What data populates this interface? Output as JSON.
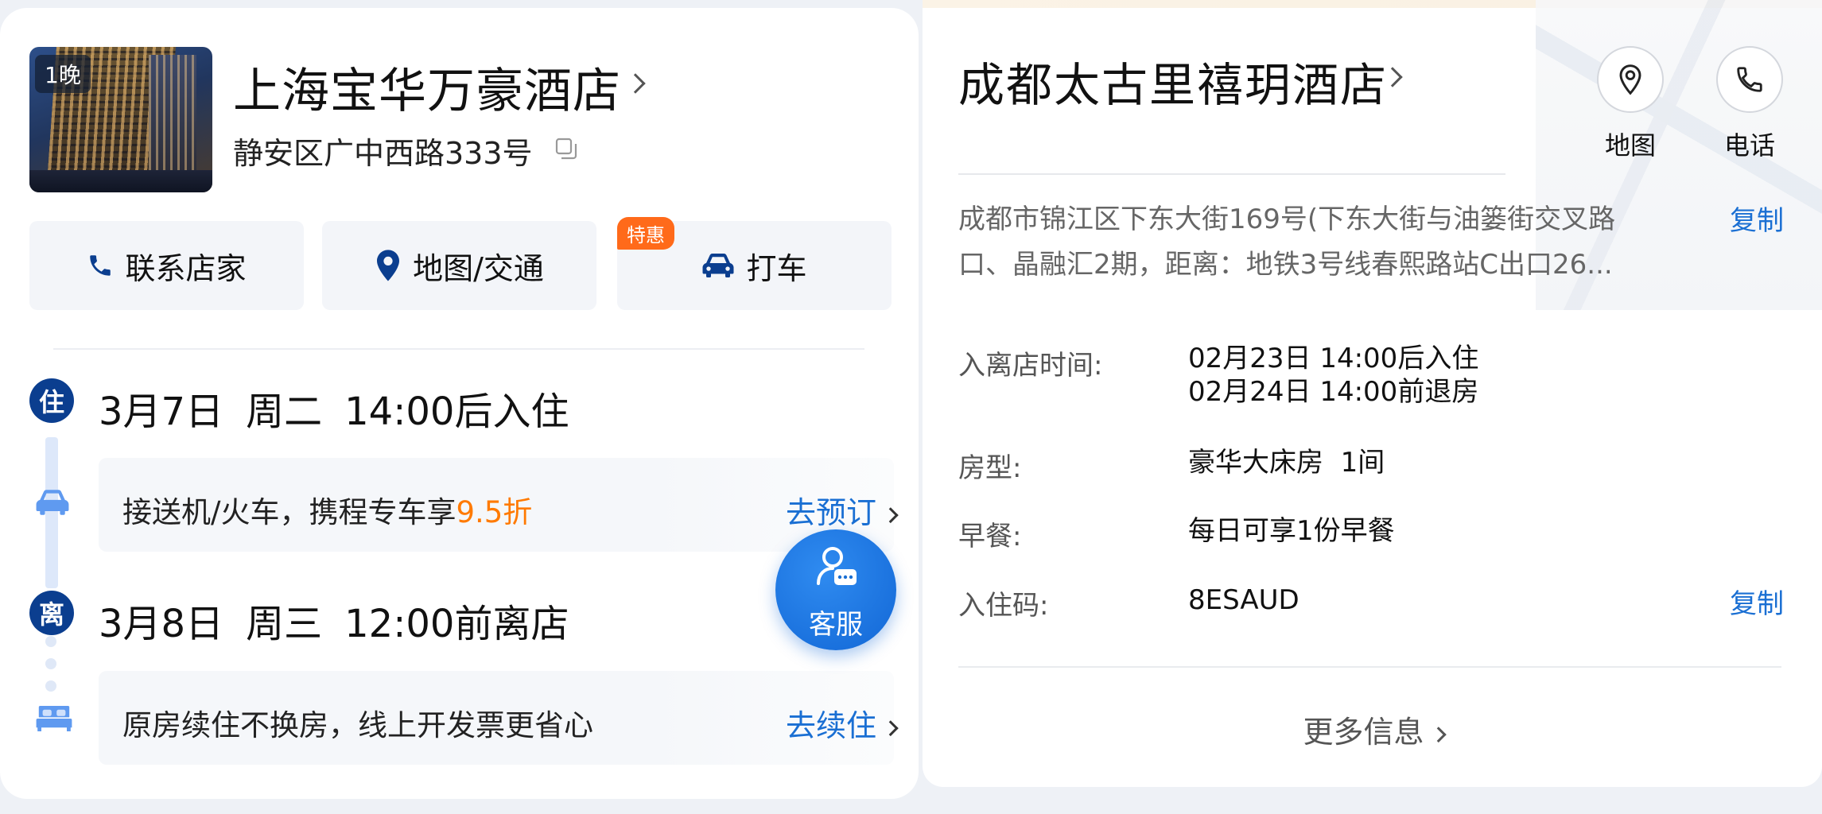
{
  "left": {
    "nights_badge": "1晚",
    "hotel_name": "上海宝华万豪酒店",
    "address": "静安区广中西路333号",
    "actions": {
      "contact": "联系店家",
      "map": "地图/交通",
      "taxi": "打车",
      "taxi_tag": "特惠"
    },
    "checkin": {
      "tag": "住",
      "date": "3月7日",
      "weekday": "周二",
      "time": "14:00后入住"
    },
    "transfer_promo": {
      "text": "接送机/火车，携程专车享",
      "discount": "9.5折",
      "link": "去预订"
    },
    "checkout": {
      "tag": "离",
      "date": "3月8日",
      "weekday": "周三",
      "time": "12:00前离店"
    },
    "extend_promo": {
      "text": "原房续住不换房，线上开发票更省心",
      "link": "去续住"
    },
    "customer_service": "客服"
  },
  "right": {
    "hotel_name": "成都太古里禧玥酒店",
    "map_label": "地图",
    "phone_label": "电话",
    "address_line1": "成都市锦江区下东大街169号(下东大街与油篓街交叉路",
    "address_line2": "口、晶融汇2期，距离：地铁3号线春熙路站C出口26...",
    "copy_label": "复制",
    "details": {
      "time_label": "入离店时间:",
      "checkin_time": "02月23日 14:00后入住",
      "checkout_time": "02月24日 14:00前退房",
      "room_label": "房型:",
      "room_value": "豪华大床房  1间",
      "breakfast_label": "早餐:",
      "breakfast_value": "每日可享1份早餐",
      "code_label": "入住码:",
      "code_value": "8ESAUD",
      "code_copy": "复制"
    },
    "more_info": "更多信息"
  },
  "colors": {
    "accent_blue": "#1a6fd3",
    "brand_navy": "#0b3e8f",
    "discount_orange": "#ff7a00",
    "tag_orange": "#ff6a1a"
  },
  "icons": [
    "phone-icon",
    "location-pin-icon",
    "car-icon",
    "copy-icon",
    "bed-icon",
    "customer-service-icon",
    "map-pin-outline-icon",
    "phone-outline-icon",
    "chevron-right-icon"
  ]
}
